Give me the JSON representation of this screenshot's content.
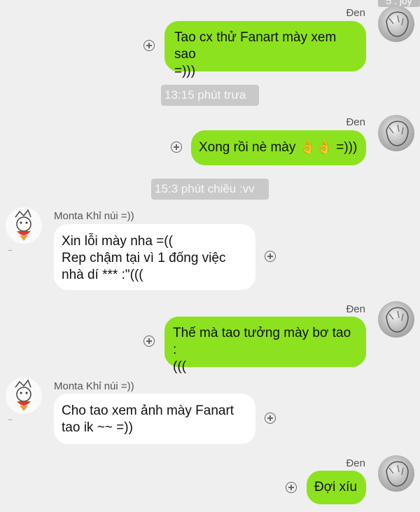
{
  "top_badge": {
    "text": "5 . joy"
  },
  "messages": [
    {
      "sender": "Đen",
      "text": "Tao cx thử Fanart mày xem sao\n=)))"
    },
    {
      "sender": "Đen",
      "text": "Xong rồi nè mày 👌👌 =)))"
    },
    {
      "sender": "Monta Khỉ núi =))",
      "text": "Xin lỗi mày nha =((\nRep chậm tại vì 1 đống việc\nnhà dí *** :\"((("
    },
    {
      "sender": "Đen",
      "text": "Thế mà tao tưởng mày bơ tao :\n((("
    },
    {
      "sender": "Monta Khỉ núi =))",
      "text": "Cho tao xem ảnh mày Fanart\ntao ik ~~ =))"
    },
    {
      "sender": "Đen",
      "text": "Đợi xíu"
    }
  ],
  "timestamps": [
    "13:15 phút trưa",
    "15:3 phút chiều :vv"
  ],
  "more_indicator": "...",
  "colors": {
    "outgoing": "#8ce21e",
    "incoming": "#ffffff",
    "background": "#efefef",
    "time_pill": "#c9c9c9"
  }
}
